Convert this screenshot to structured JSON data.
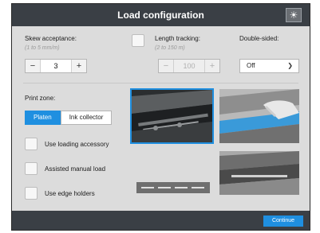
{
  "title": "Load configuration",
  "brightness_icon": "sun-icon",
  "skew": {
    "label": "Skew acceptance:",
    "hint": "(1 to 5 mm/m)",
    "value": "3",
    "minus": "−",
    "plus": "+"
  },
  "length": {
    "label": "Length tracking:",
    "hint": "(2 to 150 m)",
    "value": "100",
    "minus": "−",
    "plus": "+"
  },
  "double_sided": {
    "label": "Double-sided:",
    "value": "Off"
  },
  "print_zone": {
    "label": "Print zone:",
    "options": [
      "Platen",
      "Ink collector"
    ],
    "selected": "Platen"
  },
  "options": {
    "loading_accessory": "Use loading accessory",
    "assisted_manual_load": "Assisted manual load",
    "edge_holders": "Use edge holders"
  },
  "footer": {
    "continue": "Continue"
  },
  "colors": {
    "accent": "#1f8fe0",
    "titlebar": "#3a3f45",
    "panel": "#dcdcdc"
  }
}
